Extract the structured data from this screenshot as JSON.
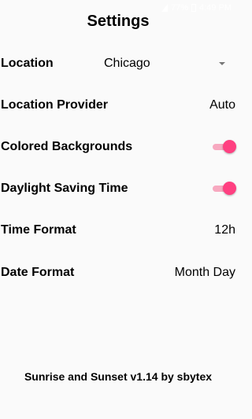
{
  "status_bar": {
    "battery": "77%",
    "time": "4:49 PM",
    "color": "#ffffff"
  },
  "title": "Settings",
  "settings": {
    "location": {
      "label": "Location",
      "value": "Chicago"
    },
    "location_provider": {
      "label": "Location Provider",
      "value": "Auto"
    },
    "colored_backgrounds": {
      "label": "Colored Backgrounds",
      "enabled": true
    },
    "daylight_saving_time": {
      "label": "Daylight Saving Time",
      "enabled": true
    },
    "time_format": {
      "label": "Time Format",
      "value": "12h"
    },
    "date_format": {
      "label": "Date Format",
      "value": "Month Day"
    }
  },
  "footer": "Sunrise and Sunset v1.14 by sbytex",
  "colors": {
    "accent": "#ff4081",
    "accent_track": "#f7a9c0",
    "background": "#fafafa"
  }
}
